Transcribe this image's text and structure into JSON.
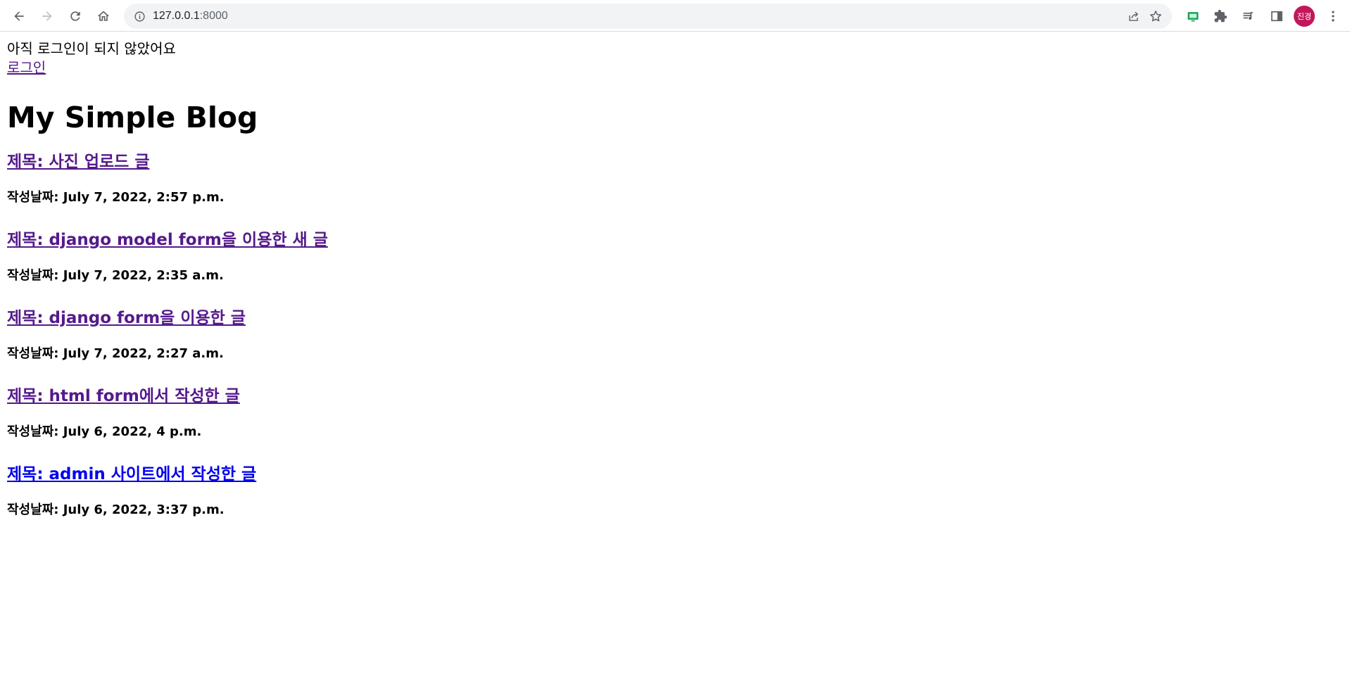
{
  "browser": {
    "url_host": "127.0.0.1",
    "url_port": ":8000",
    "profile_initials": "진경",
    "icons": {
      "back": "arrow-left-icon",
      "forward": "arrow-right-icon",
      "reload": "reload-icon",
      "home": "home-icon",
      "site_info": "info-icon",
      "share": "share-icon",
      "bookmark": "star-icon",
      "extension_green": "screen-cast-icon",
      "extensions": "puzzle-icon",
      "media": "playlist-icon",
      "side_panel": "side-panel-icon",
      "menu": "kebab-menu-icon"
    }
  },
  "auth": {
    "status_text": "아직 로그인이 되지 않았어요",
    "login_link": "로그인"
  },
  "blog": {
    "title": "My Simple Blog",
    "posts": [
      {
        "title": "제목: 사진 업로드 글",
        "date": "작성날짜: July 7, 2022, 2:57 p.m.",
        "visited": true
      },
      {
        "title": "제목: django model form을 이용한 새 글",
        "date": "작성날짜: July 7, 2022, 2:35 a.m.",
        "visited": true
      },
      {
        "title": "제목: django form을 이용한 글",
        "date": "작성날짜: July 7, 2022, 2:27 a.m.",
        "visited": true
      },
      {
        "title": "제목: html form에서 작성한 글",
        "date": "작성날짜: July 6, 2022, 4 p.m.",
        "visited": true
      },
      {
        "title": "제목: admin 사이트에서 작성한 글",
        "date": "작성날짜: July 6, 2022, 3:37 p.m.",
        "visited": false
      }
    ]
  },
  "colors": {
    "visited_link": "#551a8b",
    "unvisited_link": "#0000ee",
    "avatar_bg": "#c2185b",
    "omnibox_bg": "#f1f3f4"
  }
}
